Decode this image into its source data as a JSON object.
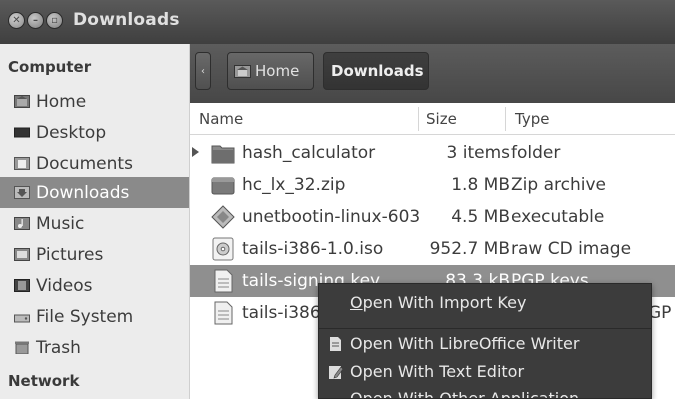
{
  "window": {
    "title": "Downloads",
    "close_glyph": "✕",
    "min_glyph": "–",
    "max_glyph": "▫"
  },
  "sidebar": {
    "section_computer": "Computer",
    "section_network": "Network",
    "items": [
      {
        "label": "Home",
        "icon": "home-icon"
      },
      {
        "label": "Desktop",
        "icon": "desktop-icon"
      },
      {
        "label": "Documents",
        "icon": "documents-icon"
      },
      {
        "label": "Downloads",
        "icon": "downloads-icon",
        "active": true
      },
      {
        "label": "Music",
        "icon": "music-icon"
      },
      {
        "label": "Pictures",
        "icon": "pictures-icon"
      },
      {
        "label": "Videos",
        "icon": "videos-icon"
      },
      {
        "label": "File System",
        "icon": "filesystem-icon"
      },
      {
        "label": "Trash",
        "icon": "trash-icon"
      }
    ]
  },
  "toolbar": {
    "back_glyph": "‹",
    "crumbs": [
      {
        "label": "Home",
        "icon": "home-icon"
      },
      {
        "label": "Downloads"
      }
    ]
  },
  "columns": {
    "name": "Name",
    "size": "Size",
    "type": "Type"
  },
  "files": [
    {
      "name": "hash_calculator",
      "size": "3 items",
      "type": "folder",
      "icon": "folder-icon",
      "expandable": true
    },
    {
      "name": "hc_lx_32.zip",
      "size": "1.8 MB",
      "type": "Zip archive",
      "icon": "archive-icon"
    },
    {
      "name": "unetbootin-linux-603",
      "size": "4.5 MB",
      "type": "executable",
      "icon": "executable-icon"
    },
    {
      "name": "tails-i386-1.0.iso",
      "size": "952.7 MB",
      "type": "raw CD image",
      "icon": "disc-image-icon"
    },
    {
      "name": "tails-signing.key",
      "size": "83.3 kB",
      "type": "PGP keys",
      "icon": "text-file-icon",
      "selected": true
    },
    {
      "name": "tails-i386",
      "size": "",
      "type": "GP",
      "icon": "text-file-icon"
    }
  ],
  "context_menu": {
    "items": [
      {
        "label": "Open With Import Key",
        "mnemonic": "O",
        "rest": "pen With Import Key"
      },
      {
        "label": "Open With LibreOffice Writer",
        "icon": "document-icon"
      },
      {
        "label": "Open With Text Editor",
        "icon": "text-editor-icon"
      },
      {
        "label": "Open With Other Application"
      }
    ]
  },
  "colors": {
    "selection": "#8f8f8f",
    "menu_bg": "#3c3c3c",
    "titlebar": "#4a4a4a"
  }
}
